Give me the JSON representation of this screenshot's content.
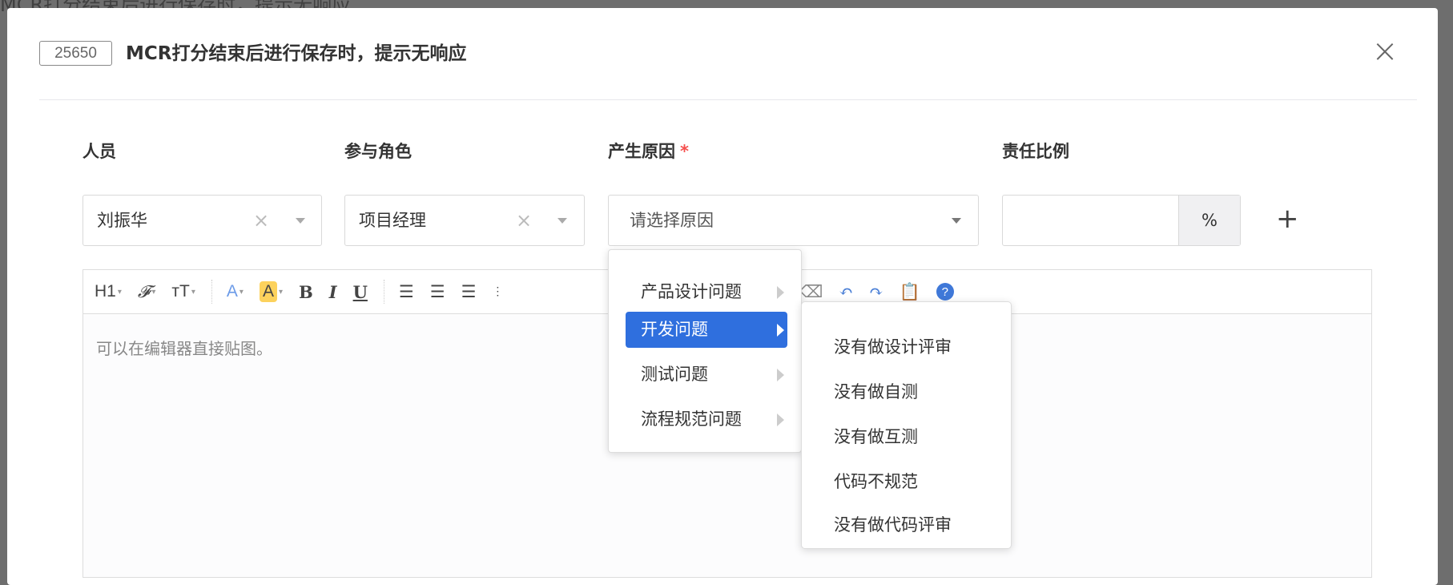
{
  "background_title": "MCR打分结束后进行保存时，提示无响应",
  "modal": {
    "issue_id": "25650",
    "title": "MCR打分结束后进行保存时，提示无响应",
    "close_icon": "close-icon"
  },
  "form": {
    "labels": {
      "person": "人员",
      "role": "参与角色",
      "cause": "产生原因",
      "required_mark": "*",
      "ratio": "责任比例"
    },
    "person_value": "刘振华",
    "role_value": "项目经理",
    "cause_placeholder": "请选择原因",
    "ratio_value": "",
    "ratio_unit": "%",
    "add_label": "+",
    "clear_glyph": "×"
  },
  "editor": {
    "toolbar": {
      "h1": "H1",
      "font": "𝓕",
      "size": "тT",
      "font_color": "A",
      "bg_color": "A",
      "bold": "B",
      "italic": "I",
      "underline": "U"
    },
    "placeholder": "可以在编辑器直接贴图。"
  },
  "cause_menu": {
    "items": [
      {
        "label": "产品设计问题"
      },
      {
        "label": "开发问题",
        "active": true
      },
      {
        "label": "测试问题"
      },
      {
        "label": "流程规范问题"
      }
    ],
    "submenu": [
      {
        "label": "没有做设计评审"
      },
      {
        "label": "没有做自测"
      },
      {
        "label": "没有做互测"
      },
      {
        "label": "代码不规范"
      },
      {
        "label": "没有做代码评审"
      }
    ]
  },
  "colors": {
    "accent": "#2f6fde",
    "required": "#f5504e"
  }
}
